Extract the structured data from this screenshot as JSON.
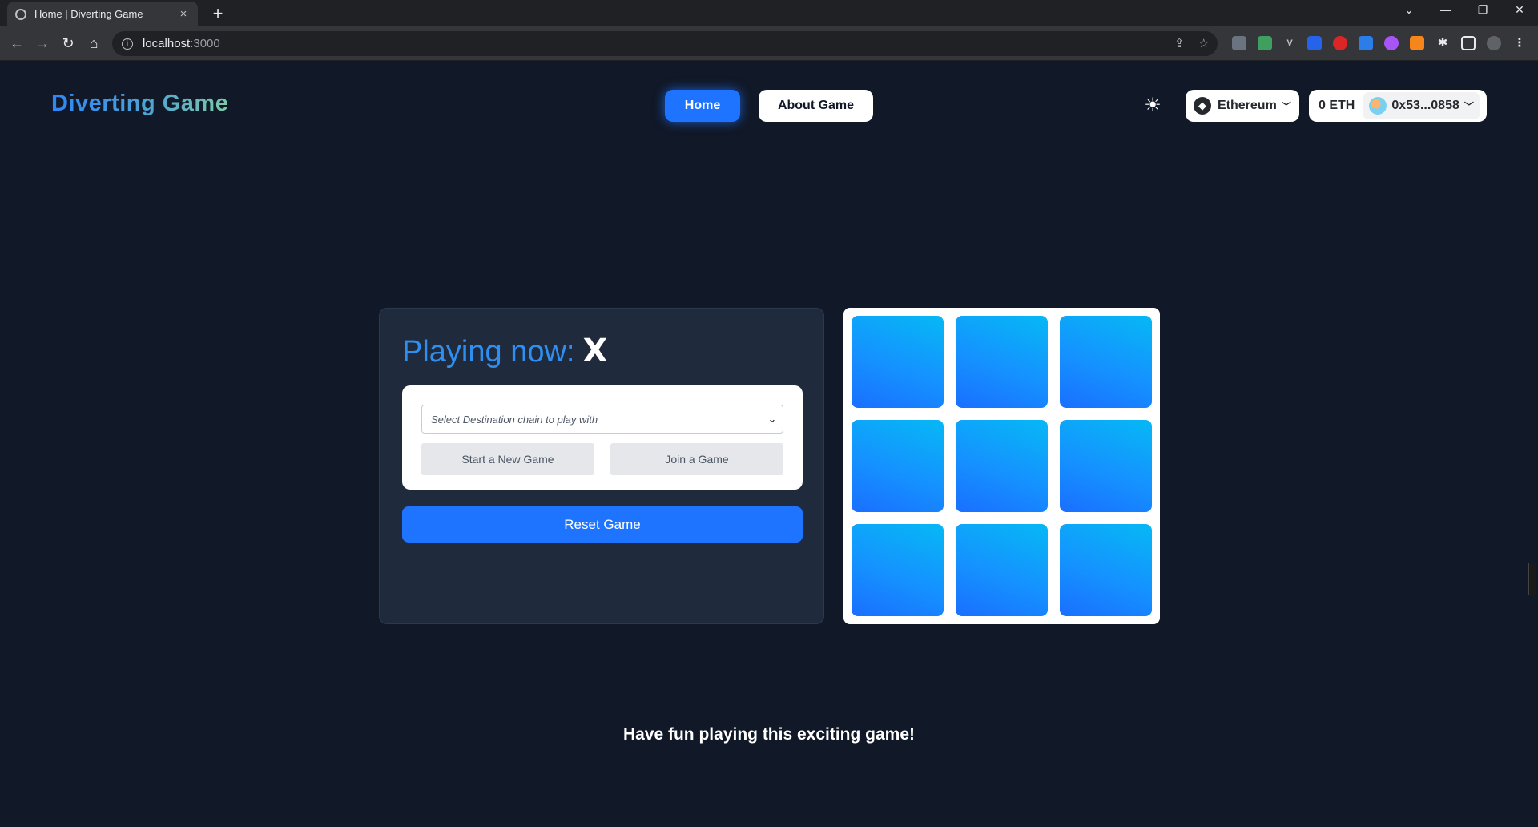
{
  "browser": {
    "tab_title": "Home | Diverting Game",
    "tab_close": "×",
    "new_tab": "+",
    "url_host": "localhost",
    "url_port": ":3000",
    "window_minimize": "—",
    "window_restore": "❐",
    "window_close": "✕",
    "tab_search": "⌄"
  },
  "header": {
    "brand": "Diverting Game",
    "nav": {
      "home_label": "Home",
      "about_label": "About Game"
    },
    "theme_icon": "sun-icon",
    "network": {
      "label": "Ethereum"
    },
    "account": {
      "balance": "0 ETH",
      "address": "0x53...0858"
    }
  },
  "game": {
    "playing_label": "Playing now:",
    "current_player": "X",
    "select": {
      "placeholder": "Select Destination chain to play with"
    },
    "start_label": "Start a New Game",
    "join_label": "Join a Game",
    "reset_label": "Reset Game",
    "board": [
      "",
      "",
      "",
      "",
      "",
      "",
      "",
      "",
      ""
    ]
  },
  "footer": {
    "text": "Have fun playing this exciting game!"
  },
  "colors": {
    "page_bg": "#111827",
    "panel_bg": "#1f2a3d",
    "accent": "#1f74ff",
    "cell_gradient_top": "#06b8f5",
    "cell_gradient_bottom": "#1a6fff"
  }
}
